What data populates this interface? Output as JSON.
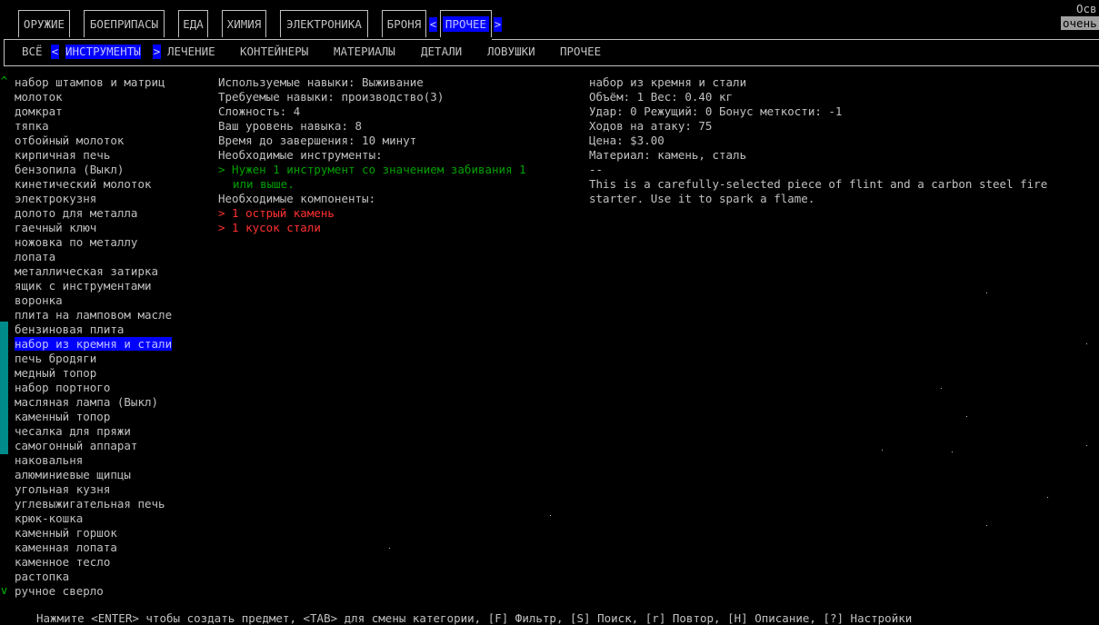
{
  "top_tabs": [
    {
      "label": "ОРУЖИЕ"
    },
    {
      "label": "БОЕПРИПАСЫ"
    },
    {
      "label": "ЕДА"
    },
    {
      "label": "ХИМИЯ"
    },
    {
      "label": "ЭЛЕКТРОНИКА"
    },
    {
      "label": "БРОНЯ"
    },
    {
      "label": "ПРОЧЕЕ"
    }
  ],
  "top_arrows": {
    "left": "<",
    "right": ">"
  },
  "top_right": {
    "line1": "Осв",
    "line2": "очень"
  },
  "sub_tabs": [
    {
      "label": "ВСЁ"
    },
    {
      "label": "ИНСТРУМЕНТЫ"
    },
    {
      "label": "ЛЕЧЕНИЕ"
    },
    {
      "label": "КОНТЕЙНЕРЫ"
    },
    {
      "label": "МАТЕРИАЛЫ"
    },
    {
      "label": "ДЕТАЛИ"
    },
    {
      "label": "ЛОВУШКИ"
    },
    {
      "label": "ПРОЧЕЕ"
    }
  ],
  "sub_arrows": {
    "left": "<",
    "right": ">"
  },
  "scroll": {
    "up": "^",
    "down": "v"
  },
  "items": [
    "набор штампов и матриц",
    "молоток",
    "домкрат",
    "тяпка",
    "отбойный молоток",
    "кирпичная печь",
    "бензопила (Выкл)",
    "кинетический молоток",
    "электрокузня",
    "долото для металла",
    "гаечный ключ",
    "ножовка по металлу",
    "лопата",
    "металлическая затирка",
    "ящик с инструментами",
    "воронка",
    "плита на ламповом масле",
    "бензиновая плита",
    "набор из кремня и стали",
    "печь бродяги",
    "медный топор",
    "набор портного",
    "масляная лампа (Выкл)",
    "каменный топор",
    "чесалка для пряжи",
    "самогонный аппарат",
    "наковальня",
    "алюминиевые щипцы",
    "угольная кузня",
    "углевыжигательная печь",
    "крюк-кошка",
    "каменный горшок",
    "каменная лопата",
    "каменное тесло",
    "растопка",
    "ручное сверло"
  ],
  "selected_item_index": 18,
  "recipe": {
    "used_skills": "Используемые навыки: Выживание",
    "required_skills": "Требуемые навыки: производство(3)",
    "difficulty": "Сложность: 4",
    "your_skill": "Ваш уровень навыка: 8",
    "time": "Время до завершения: 10 минут",
    "tools_header": "Необходимые инструменты:",
    "tool_line1": "> Нужен 1 инструмент со значением забивания 1",
    "tool_line2": "или выше.",
    "components_header": "Необходимые компоненты:",
    "component1": "> 1 острый камень",
    "component2": "> 1 кусок стали"
  },
  "details": {
    "name": "набор из кремня и стали",
    "volume_weight": "Объём: 1 Вес: 0.40 кг",
    "damage": "Удар: 0 Режущий: 0 Бонус меткости: -1",
    "moves": "Ходов на атаку: 75",
    "price": "Цена: $3.00",
    "material": "Материал: камень, сталь",
    "separator": "--",
    "desc1": "This is a carefully-selected piece of flint and a carbon steel fire",
    "desc2": "starter.  Use it to spark a flame."
  },
  "help_line": "Нажмите <ENTER> чтобы создать предмет, <TAB> для смены категории, [F] Фильтр, [S] Поиск, [r] Повтор, [H] Описание, [?] Настройки"
}
